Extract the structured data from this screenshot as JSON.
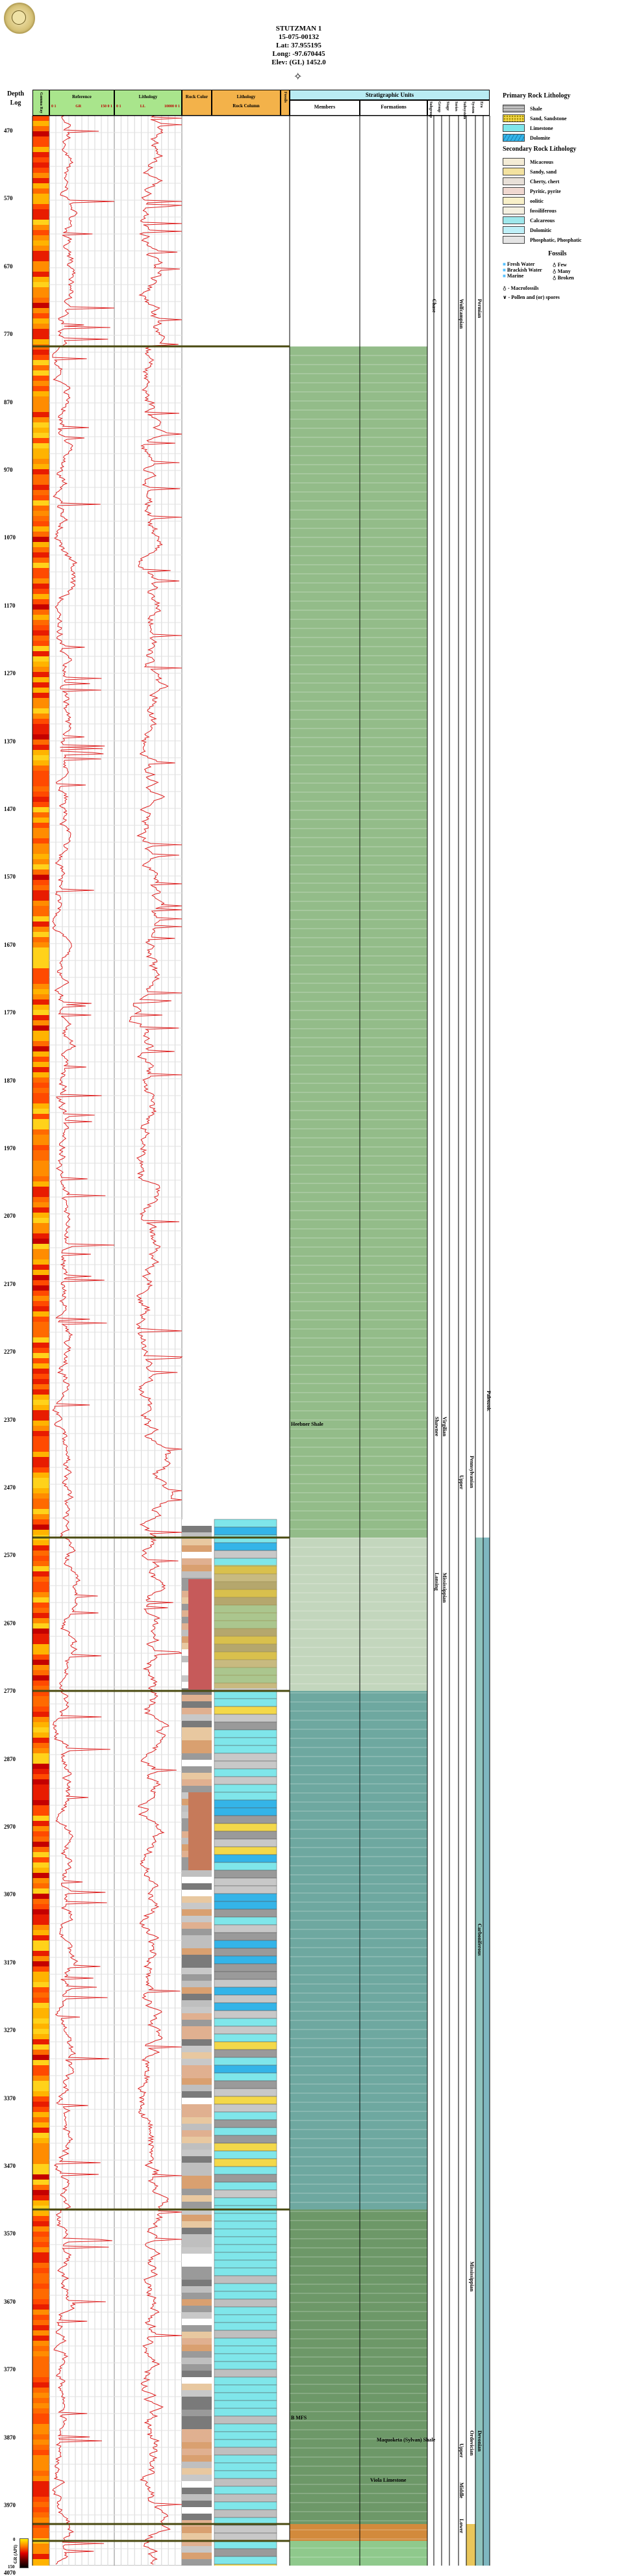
{
  "header": {
    "well_name": "STUTZMAN 1",
    "api": "15-075-00132",
    "lat": "Lat: 37.955195",
    "long": "Long: -97.670445",
    "elev": "Elev: (GL) 1452.0"
  },
  "columns": {
    "depth": "Depth",
    "log": "Log",
    "gamma": "Gamma Ray",
    "reference": "Reference",
    "lithology_log": "Lithology",
    "rock_color": "Rock Color",
    "lithology_col": "Lithology",
    "rock_column": "Rock Column",
    "fossils": "Fossils",
    "strat_units": "Stratigraphic Units",
    "members": "Members",
    "formations": "Formations",
    "ref_scale_left": "0 1",
    "ref_scale_gr": "GR",
    "ref_scale_right": "150 0 1",
    "lith_scale_left": "0 1",
    "lith_scale_gr": "LL",
    "lith_scale_right": "10000 0 1",
    "strat_sub": [
      "Subgroup",
      "Group",
      "Stage",
      "Series",
      "Subsystem",
      "System",
      "Era"
    ]
  },
  "depths": [
    "470",
    "570",
    "670",
    "770",
    "870",
    "970",
    "1070",
    "1170",
    "1270",
    "1370",
    "1470",
    "1570",
    "1670",
    "1770",
    "1870",
    "1970",
    "2070",
    "2170",
    "2270",
    "2370",
    "2470",
    "2570",
    "2670",
    "2770",
    "2870",
    "2970",
    "3070",
    "3170",
    "3270",
    "3370",
    "3470",
    "3570",
    "3670",
    "3770",
    "3870",
    "3970",
    "4070"
  ],
  "strat_labels": {
    "chase": "Chase",
    "wolfcampian": "Wolfcampian",
    "permian": "Permian",
    "heebner": "Heebner Shale",
    "virgilian": "Virgilian",
    "shawnee": "Shawnee",
    "pennsylvanian": "Pennsylvanian",
    "upper": "Upper",
    "mississippian_lower": "Mississippian",
    "lansing": "Lansing",
    "carboniferous": "Carboniferous",
    "mississippian": "Mississippian",
    "b_mfs": "B MFS",
    "maquoketa": "Maquoketa (Sylvan) Shale",
    "viola": "Viola Limestone",
    "ordovician": "Ordovician",
    "devonian": "Devonian",
    "upper_ord": "Upper",
    "middle_ord": "Middle",
    "lower_ord": "Lower",
    "paleozoic": "Paleozoic"
  },
  "legend": {
    "primary_title": "Primary Rock Lithology",
    "primary": [
      "Shale",
      "Sand, Sandstone",
      "Limestone",
      "Dolomite"
    ],
    "secondary_title": "Secondary Rock Lithology",
    "secondary": [
      "Micaceous",
      "Sandy, sand",
      "Cherty, chert",
      "Pyritic, pyrite",
      "oolitic",
      "fossiliferous",
      "Calcareous",
      "Dolomitic",
      "Phosphatic, Phosphatic"
    ],
    "fossils_title": "Fossils",
    "water": [
      "Fresh Water",
      "Brackish Water",
      "Marine"
    ],
    "abundance": [
      "Few",
      "Many",
      "Broken"
    ],
    "macro": "- Macrofossils",
    "pollen": "- Pollen and (or) spores"
  },
  "colorbar": {
    "unit": "GR (API)",
    "min": "0",
    "max": "150"
  },
  "colors": {
    "permian_green": "#93bc89",
    "penn_pale": "#c3d6bd",
    "penn_teal": "#6ea8a0",
    "miss_green": "#6d9868",
    "ord_orange": "#d28a3c",
    "maquoketa_green": "#8fc98c",
    "viola_teal": "#1d9b85",
    "header_cyan": "#b9ecf3",
    "limestone": "#7fe6ea",
    "dolomite": "#34b4e8",
    "sand": "#f3d84a",
    "shale": "#9a9a9a"
  }
}
